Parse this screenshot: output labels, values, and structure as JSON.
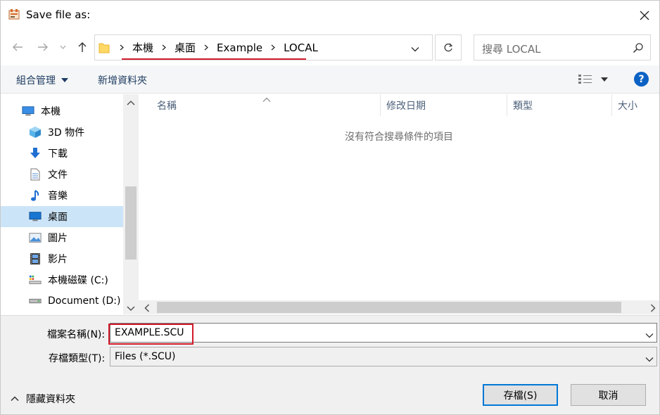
{
  "window": {
    "title": "Save file as:",
    "close_icon": "close-icon",
    "app_icon": "app-icon"
  },
  "nav": {
    "back_icon": "arrow-left-icon",
    "forward_icon": "arrow-right-icon",
    "recent_icon": "chevron-down-icon",
    "up_icon": "arrow-up-icon",
    "breadcrumbs": [
      "本機",
      "桌面",
      "Example",
      "LOCAL"
    ],
    "refresh_icon": "refresh-icon",
    "search_placeholder": "搜尋 LOCAL",
    "search_icon": "search-icon"
  },
  "commandbar": {
    "organize": "組合管理",
    "new_folder": "新增資料夾",
    "view_icon": "view-options-icon",
    "help": "?"
  },
  "sidebar": {
    "items": [
      {
        "label": "本機",
        "icon": "computer-icon"
      },
      {
        "label": "3D 物件",
        "icon": "3d-objects-icon"
      },
      {
        "label": "下載",
        "icon": "download-icon"
      },
      {
        "label": "文件",
        "icon": "document-icon"
      },
      {
        "label": "音樂",
        "icon": "music-icon"
      },
      {
        "label": "桌面",
        "icon": "desktop-icon",
        "selected": true
      },
      {
        "label": "圖片",
        "icon": "pictures-icon"
      },
      {
        "label": "影片",
        "icon": "videos-icon"
      },
      {
        "label": "本機磁碟 (C:)",
        "icon": "drive-c-icon"
      },
      {
        "label": "Document (D:)",
        "icon": "drive-d-icon"
      }
    ]
  },
  "filelist": {
    "columns": [
      "名稱",
      "修改日期",
      "類型",
      "大小"
    ],
    "empty_message": "沒有符合搜尋條件的項目"
  },
  "bottom": {
    "filename_label": "檔案名稱(N):",
    "filename_value": "EXAMPLE.SCU",
    "filetype_label": "存檔類型(T):",
    "filetype_value": "Files (*.SCU)",
    "hide_folders": "隱藏資料夾",
    "save": "存檔(S)",
    "cancel": "取消"
  },
  "colors": {
    "accent": "#0078d7",
    "highlight_red": "#d11a2a",
    "selected_bg": "#cce4f7"
  }
}
